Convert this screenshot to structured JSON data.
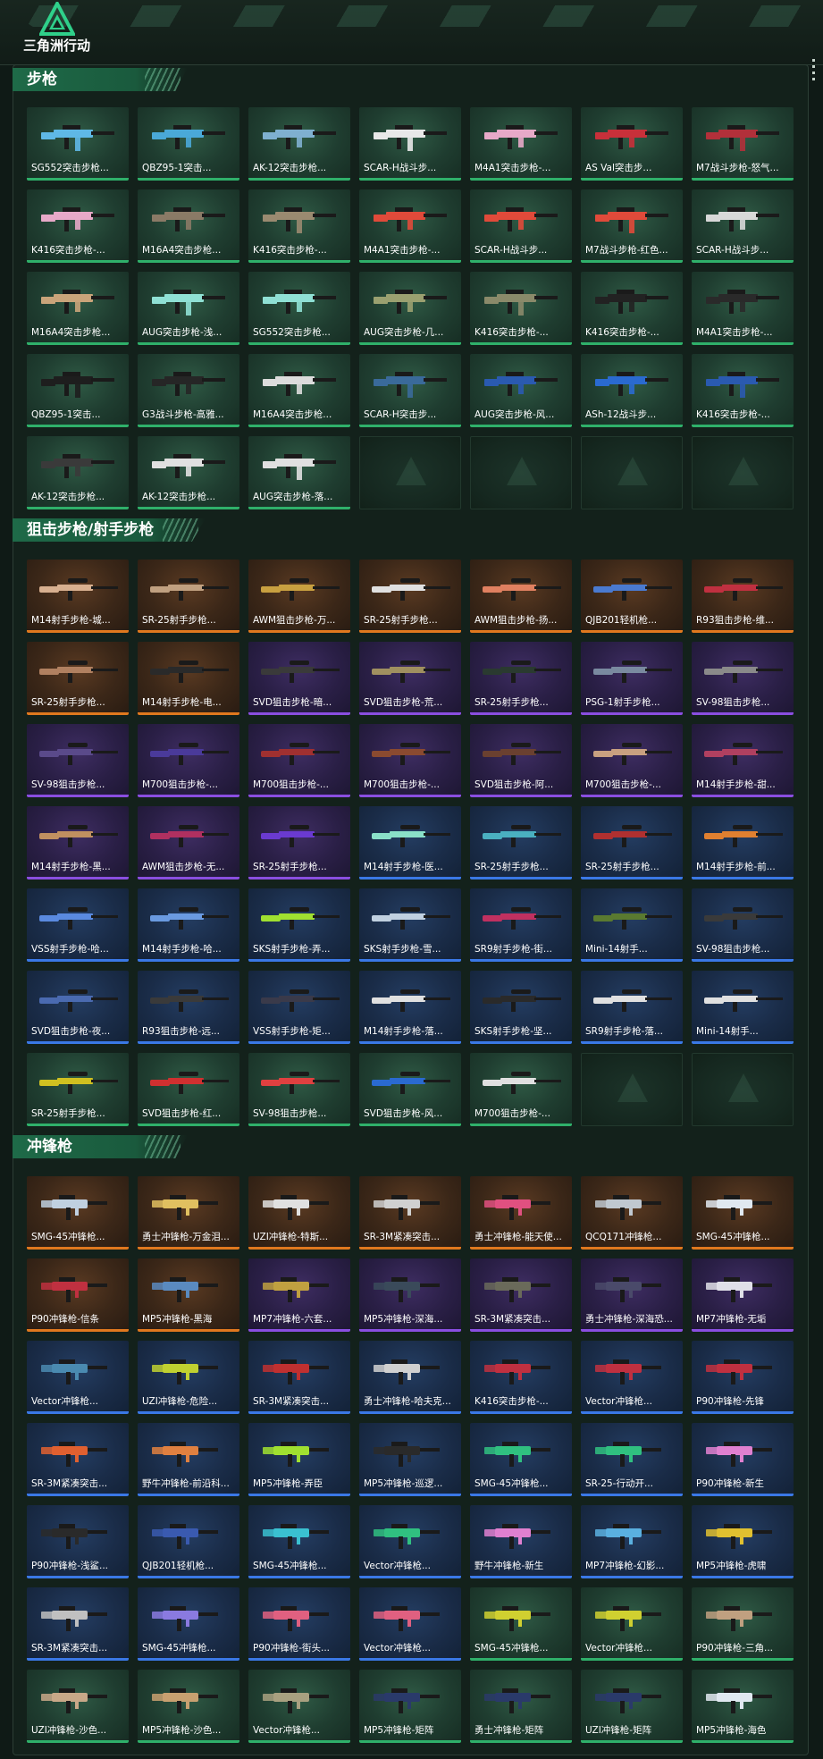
{
  "header": {
    "logo_text": "三角洲行动"
  },
  "sections": [
    {
      "title": "步枪",
      "items": [
        {
          "label": "SG552突击步枪...",
          "tier": "green",
          "color": "#5fb8e6"
        },
        {
          "label": "QBZ95-1突击...",
          "tier": "green",
          "color": "#4aa9d8"
        },
        {
          "label": "AK-12突击步枪...",
          "tier": "green",
          "color": "#7fb0d0"
        },
        {
          "label": "SCAR-H战斗步...",
          "tier": "green",
          "color": "#e8e8e8"
        },
        {
          "label": "M4A1突击步枪-...",
          "tier": "green",
          "color": "#e7a9c8"
        },
        {
          "label": "AS Val突击步...",
          "tier": "green",
          "color": "#c8303a"
        },
        {
          "label": "M7战斗步枪-怒气...",
          "tier": "green",
          "color": "#b2303a"
        },
        {
          "label": "K416突击步枪-...",
          "tier": "green",
          "color": "#e7a9c8"
        },
        {
          "label": "M16A4突击步枪...",
          "tier": "green",
          "color": "#8a7a66"
        },
        {
          "label": "K416突击步枪-...",
          "tier": "green",
          "color": "#9a8a70"
        },
        {
          "label": "M4A1突击步枪-...",
          "tier": "green",
          "color": "#e04a3a"
        },
        {
          "label": "SCAR-H战斗步...",
          "tier": "green",
          "color": "#e04a3a"
        },
        {
          "label": "M7战斗步枪-红色...",
          "tier": "green",
          "color": "#e04a3a"
        },
        {
          "label": "SCAR-H战斗步...",
          "tier": "green",
          "color": "#d8d8d8"
        },
        {
          "label": "M16A4突击步枪...",
          "tier": "green",
          "color": "#c9a47a"
        },
        {
          "label": "AUG突击步枪-浅...",
          "tier": "green",
          "color": "#8fe0d4"
        },
        {
          "label": "SG552突击步枪...",
          "tier": "green",
          "color": "#8fe0d4"
        },
        {
          "label": "AUG突击步枪-几...",
          "tier": "green",
          "color": "#9aa070"
        },
        {
          "label": "K416突击步枪-...",
          "tier": "green",
          "color": "#8a8a6a"
        },
        {
          "label": "K416突击步枪-...",
          "tier": "green",
          "color": "#222222"
        },
        {
          "label": "M4A1突击步枪-...",
          "tier": "green",
          "color": "#2a2a2a"
        },
        {
          "label": "QBZ95-1突击...",
          "tier": "green",
          "color": "#1e1e1e"
        },
        {
          "label": "G3战斗步枪-高雅...",
          "tier": "green",
          "color": "#262626"
        },
        {
          "label": "M16A4突击步枪...",
          "tier": "green",
          "color": "#dcdcdc"
        },
        {
          "label": "SCAR-H突击步...",
          "tier": "green",
          "color": "#3a6a9a"
        },
        {
          "label": "AUG突击步枪-风...",
          "tier": "green",
          "color": "#2a5ab0"
        },
        {
          "label": "ASh-12战斗步...",
          "tier": "green",
          "color": "#2a6ad0"
        },
        {
          "label": "K416突击步枪-...",
          "tier": "green",
          "color": "#2a5ab0"
        },
        {
          "label": "AK-12突击步枪...",
          "tier": "green",
          "color": "#3a3a3a"
        },
        {
          "label": "AK-12突击步枪...",
          "tier": "green",
          "color": "#e0e0e0"
        },
        {
          "label": "AUG突击步枪-落...",
          "tier": "green",
          "color": "#e0e0e0"
        },
        {
          "label": "",
          "tier": "empty",
          "color": ""
        },
        {
          "label": "",
          "tier": "empty",
          "color": ""
        },
        {
          "label": "",
          "tier": "empty",
          "color": ""
        },
        {
          "label": "",
          "tier": "empty",
          "color": ""
        }
      ]
    },
    {
      "title": "狙击步枪/射手步枪",
      "items": [
        {
          "label": "M14射手步枪-城...",
          "tier": "orange",
          "color": "#d8b090"
        },
        {
          "label": "SR-25射手步枪...",
          "tier": "orange",
          "color": "#c0a080"
        },
        {
          "label": "AWM狙击步枪-万...",
          "tier": "orange",
          "color": "#c8a040"
        },
        {
          "label": "SR-25射手步枪...",
          "tier": "orange",
          "color": "#e0e0e0"
        },
        {
          "label": "AWM狙击步枪-扬...",
          "tier": "orange",
          "color": "#e08060"
        },
        {
          "label": "QJB201轻机枪...",
          "tier": "orange",
          "color": "#4a7ad0"
        },
        {
          "label": "R93狙击步枪-维...",
          "tier": "orange",
          "color": "#c03040"
        },
        {
          "label": "SR-25射手步枪...",
          "tier": "orange",
          "color": "#b08060"
        },
        {
          "label": "M14射手步枪-电...",
          "tier": "orange",
          "color": "#2a2a2a"
        },
        {
          "label": "SVD狙击步枪-暗...",
          "tier": "purple",
          "color": "#3a3a3a"
        },
        {
          "label": "SVD狙击步枪-荒...",
          "tier": "purple",
          "color": "#a09060"
        },
        {
          "label": "SR-25射手步枪...",
          "tier": "purple",
          "color": "#2a3a30"
        },
        {
          "label": "PSG-1射手步枪...",
          "tier": "purple",
          "color": "#7a8aa0"
        },
        {
          "label": "SV-98狙击步枪...",
          "tier": "purple",
          "color": "#8a8a8a"
        },
        {
          "label": "SV-98狙击步枪...",
          "tier": "purple",
          "color": "#5a4a8a"
        },
        {
          "label": "M700狙击步枪-...",
          "tier": "purple",
          "color": "#4a3a9a"
        },
        {
          "label": "M700狙击步枪-...",
          "tier": "purple",
          "color": "#a03030"
        },
        {
          "label": "M700狙击步枪-...",
          "tier": "purple",
          "color": "#8a4a30"
        },
        {
          "label": "SVD狙击步枪-阿...",
          "tier": "purple",
          "color": "#6a4030"
        },
        {
          "label": "M700狙击步枪-...",
          "tier": "purple",
          "color": "#c8a080"
        },
        {
          "label": "M14射手步枪-甜...",
          "tier": "purple",
          "color": "#b04060"
        },
        {
          "label": "M14射手步枪-黑...",
          "tier": "purple",
          "color": "#c09060"
        },
        {
          "label": "AWM狙击步枪-无...",
          "tier": "purple",
          "color": "#b03060"
        },
        {
          "label": "SR-25射手步枪...",
          "tier": "purple",
          "color": "#6a3ad0"
        },
        {
          "label": "M14射手步枪-医...",
          "tier": "blue",
          "color": "#8ae0c8"
        },
        {
          "label": "SR-25射手步枪...",
          "tier": "blue",
          "color": "#4ab0c0"
        },
        {
          "label": "SR-25射手步枪...",
          "tier": "blue",
          "color": "#b03030"
        },
        {
          "label": "M14射手步枪-前...",
          "tier": "blue",
          "color": "#e08030"
        },
        {
          "label": "VSS射手步枪-哈...",
          "tier": "blue",
          "color": "#5a8ae0"
        },
        {
          "label": "M14射手步枪-哈...",
          "tier": "blue",
          "color": "#6a9ae0"
        },
        {
          "label": "SKS射手步枪-弄...",
          "tier": "blue",
          "color": "#a0e030"
        },
        {
          "label": "SKS射手步枪-雪...",
          "tier": "blue",
          "color": "#c0d0e0"
        },
        {
          "label": "SR9射手步枪-街...",
          "tier": "blue",
          "color": "#c03060"
        },
        {
          "label": "Mini-14射手...",
          "tier": "blue",
          "color": "#5a7a30"
        },
        {
          "label": "SV-98狙击步枪...",
          "tier": "blue",
          "color": "#3a3a3a"
        },
        {
          "label": "SVD狙击步枪-夜...",
          "tier": "blue",
          "color": "#4a6ab0"
        },
        {
          "label": "R93狙击步枪-远...",
          "tier": "blue",
          "color": "#3a3a3a"
        },
        {
          "label": "VSS射手步枪-矩...",
          "tier": "blue",
          "color": "#3a3a4a"
        },
        {
          "label": "M14射手步枪-落...",
          "tier": "blue",
          "color": "#e0e0e0"
        },
        {
          "label": "SKS射手步枪-坚...",
          "tier": "blue",
          "color": "#2a2a2a"
        },
        {
          "label": "SR9射手步枪-落...",
          "tier": "blue",
          "color": "#e0e0e0"
        },
        {
          "label": "Mini-14射手...",
          "tier": "blue",
          "color": "#e0e0e0"
        },
        {
          "label": "SR-25射手步枪...",
          "tier": "green",
          "color": "#d0c020"
        },
        {
          "label": "SVD狙击步枪-红...",
          "tier": "green",
          "color": "#d03030"
        },
        {
          "label": "SV-98狙击步枪...",
          "tier": "green",
          "color": "#e04040"
        },
        {
          "label": "SVD狙击步枪-风...",
          "tier": "green",
          "color": "#2a6ad0"
        },
        {
          "label": "M700狙击步枪-...",
          "tier": "green",
          "color": "#e0e0e0"
        },
        {
          "label": "",
          "tier": "empty",
          "color": ""
        },
        {
          "label": "",
          "tier": "empty",
          "color": ""
        }
      ]
    },
    {
      "title": "冲锋枪",
      "items": [
        {
          "label": "SMG-45冲锋枪...",
          "tier": "orange",
          "color": "#c0d0e0"
        },
        {
          "label": "勇士冲锋枪-万金泪...",
          "tier": "orange",
          "color": "#e0c060"
        },
        {
          "label": "UZI冲锋枪-特斯...",
          "tier": "orange",
          "color": "#e0e0e0"
        },
        {
          "label": "SR-3M紧凑突击...",
          "tier": "orange",
          "color": "#d0d0d0"
        },
        {
          "label": "勇士冲锋枪-能天使...",
          "tier": "orange",
          "color": "#e05080"
        },
        {
          "label": "QCQ171冲锋枪...",
          "tier": "orange",
          "color": "#c0c8d0"
        },
        {
          "label": "SMG-45冲锋枪...",
          "tier": "orange",
          "color": "#e0e8f0"
        },
        {
          "label": "P90冲锋枪-信条",
          "tier": "orange",
          "color": "#c03040"
        },
        {
          "label": "MP5冲锋枪-黑海",
          "tier": "orange",
          "color": "#5a8ac0"
        },
        {
          "label": "MP7冲锋枪-六套...",
          "tier": "purple",
          "color": "#c0a040"
        },
        {
          "label": "MP5冲锋枪-深海...",
          "tier": "purple",
          "color": "#3a4a5a"
        },
        {
          "label": "SR-3M紧凑突击...",
          "tier": "purple",
          "color": "#6a6a5a"
        },
        {
          "label": "勇士冲锋枪-深海恐...",
          "tier": "purple",
          "color": "#4a4a6a"
        },
        {
          "label": "MP7冲锋枪-无垢",
          "tier": "purple",
          "color": "#e0e0e8"
        },
        {
          "label": "Vector冲锋枪...",
          "tier": "blue",
          "color": "#4a8ab0"
        },
        {
          "label": "UZI冲锋枪-危险...",
          "tier": "blue",
          "color": "#c0d030"
        },
        {
          "label": "SR-3M紧凑突击...",
          "tier": "blue",
          "color": "#c03030"
        },
        {
          "label": "勇士冲锋枪-哈夫克...",
          "tier": "blue",
          "color": "#d0d0d0"
        },
        {
          "label": "K416突击步枪-...",
          "tier": "blue",
          "color": "#c03040"
        },
        {
          "label": "Vector冲锋枪...",
          "tier": "blue",
          "color": "#c03040"
        },
        {
          "label": "P90冲锋枪-先锋",
          "tier": "blue",
          "color": "#c03040"
        },
        {
          "label": "SR-3M紧凑突击...",
          "tier": "blue",
          "color": "#e06030"
        },
        {
          "label": "野牛冲锋枪-前沿科...",
          "tier": "blue",
          "color": "#e08040"
        },
        {
          "label": "MP5冲锋枪-弄臣",
          "tier": "blue",
          "color": "#a0e030"
        },
        {
          "label": "MP5冲锋枪-巡逻...",
          "tier": "blue",
          "color": "#2a2a2a"
        },
        {
          "label": "SMG-45冲锋枪...",
          "tier": "blue",
          "color": "#30c080"
        },
        {
          "label": "SR-25-行动开...",
          "tier": "blue",
          "color": "#30c080"
        },
        {
          "label": "P90冲锋枪-新生",
          "tier": "blue",
          "color": "#e080d0"
        },
        {
          "label": "P90冲锋枪-浅鲨...",
          "tier": "blue",
          "color": "#2a2a2a"
        },
        {
          "label": "QJB201轻机枪...",
          "tier": "blue",
          "color": "#3a5ab0"
        },
        {
          "label": "SMG-45冲锋枪...",
          "tier": "blue",
          "color": "#3ac0d0"
        },
        {
          "label": "Vector冲锋枪...",
          "tier": "blue",
          "color": "#30c080"
        },
        {
          "label": "野牛冲锋枪-新生",
          "tier": "blue",
          "color": "#e080d0"
        },
        {
          "label": "MP7冲锋枪-幻影...",
          "tier": "blue",
          "color": "#5ab0e0"
        },
        {
          "label": "MP5冲锋枪-虎啸",
          "tier": "blue",
          "color": "#e0c030"
        },
        {
          "label": "SR-3M紧凑突击...",
          "tier": "blue",
          "color": "#c0c0c0"
        },
        {
          "label": "SMG-45冲锋枪...",
          "tier": "blue",
          "color": "#8a7ae0"
        },
        {
          "label": "P90冲锋枪-街头...",
          "tier": "blue",
          "color": "#e06080"
        },
        {
          "label": "Vector冲锋枪...",
          "tier": "blue",
          "color": "#e06080"
        },
        {
          "label": "SMG-45冲锋枪...",
          "tier": "green",
          "color": "#d0d030"
        },
        {
          "label": "Vector冲锋枪...",
          "tier": "green",
          "color": "#d0d030"
        },
        {
          "label": "P90冲锋枪-三角...",
          "tier": "green",
          "color": "#c0a080"
        },
        {
          "label": "UZI冲锋枪-沙色...",
          "tier": "green",
          "color": "#c8a888"
        },
        {
          "label": "MP5冲锋枪-沙色...",
          "tier": "green",
          "color": "#c8a070"
        },
        {
          "label": "Vector冲锋枪...",
          "tier": "green",
          "color": "#a8a080"
        },
        {
          "label": "MP5冲锋枪-矩阵",
          "tier": "green",
          "color": "#2a3a6a"
        },
        {
          "label": "勇士冲锋枪-矩阵",
          "tier": "green",
          "color": "#2a3a6a"
        },
        {
          "label": "UZI冲锋枪-矩阵",
          "tier": "green",
          "color": "#2a3a6a"
        },
        {
          "label": "MP5冲锋枪-海色",
          "tier": "green",
          "color": "#e0e8f0"
        }
      ]
    }
  ]
}
